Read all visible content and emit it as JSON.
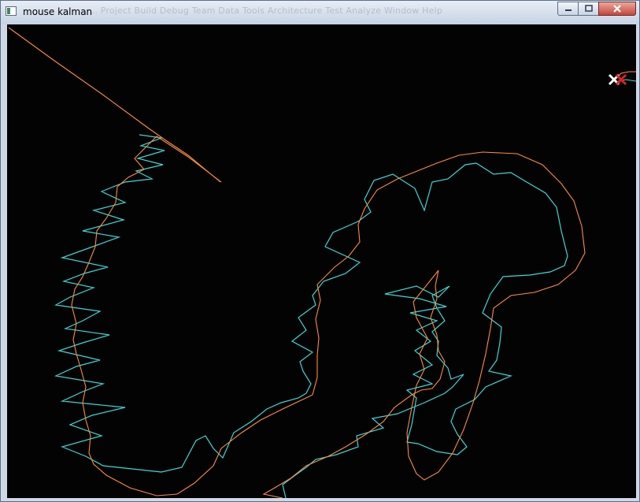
{
  "window": {
    "title": "mouse kalman",
    "ghost_menu": "...      Project    Build    Debug    Team    Data    Tools    Architecture    Test    Analyze    Window    Help"
  },
  "icons": {
    "app": "app-window-icon",
    "minimize": "minimize-icon",
    "maximize": "maximize-icon",
    "close": "close-icon",
    "mouse_marker": "white-x-cursor-icon",
    "kalman_marker": "red-x-estimate-icon"
  },
  "colors": {
    "canvas_bg": "#030303",
    "measured_path": "#3fd6d6",
    "kalman_path": "#ff8a3d",
    "mouse_marker": "#ffffff",
    "kalman_marker": "#e02020"
  }
}
